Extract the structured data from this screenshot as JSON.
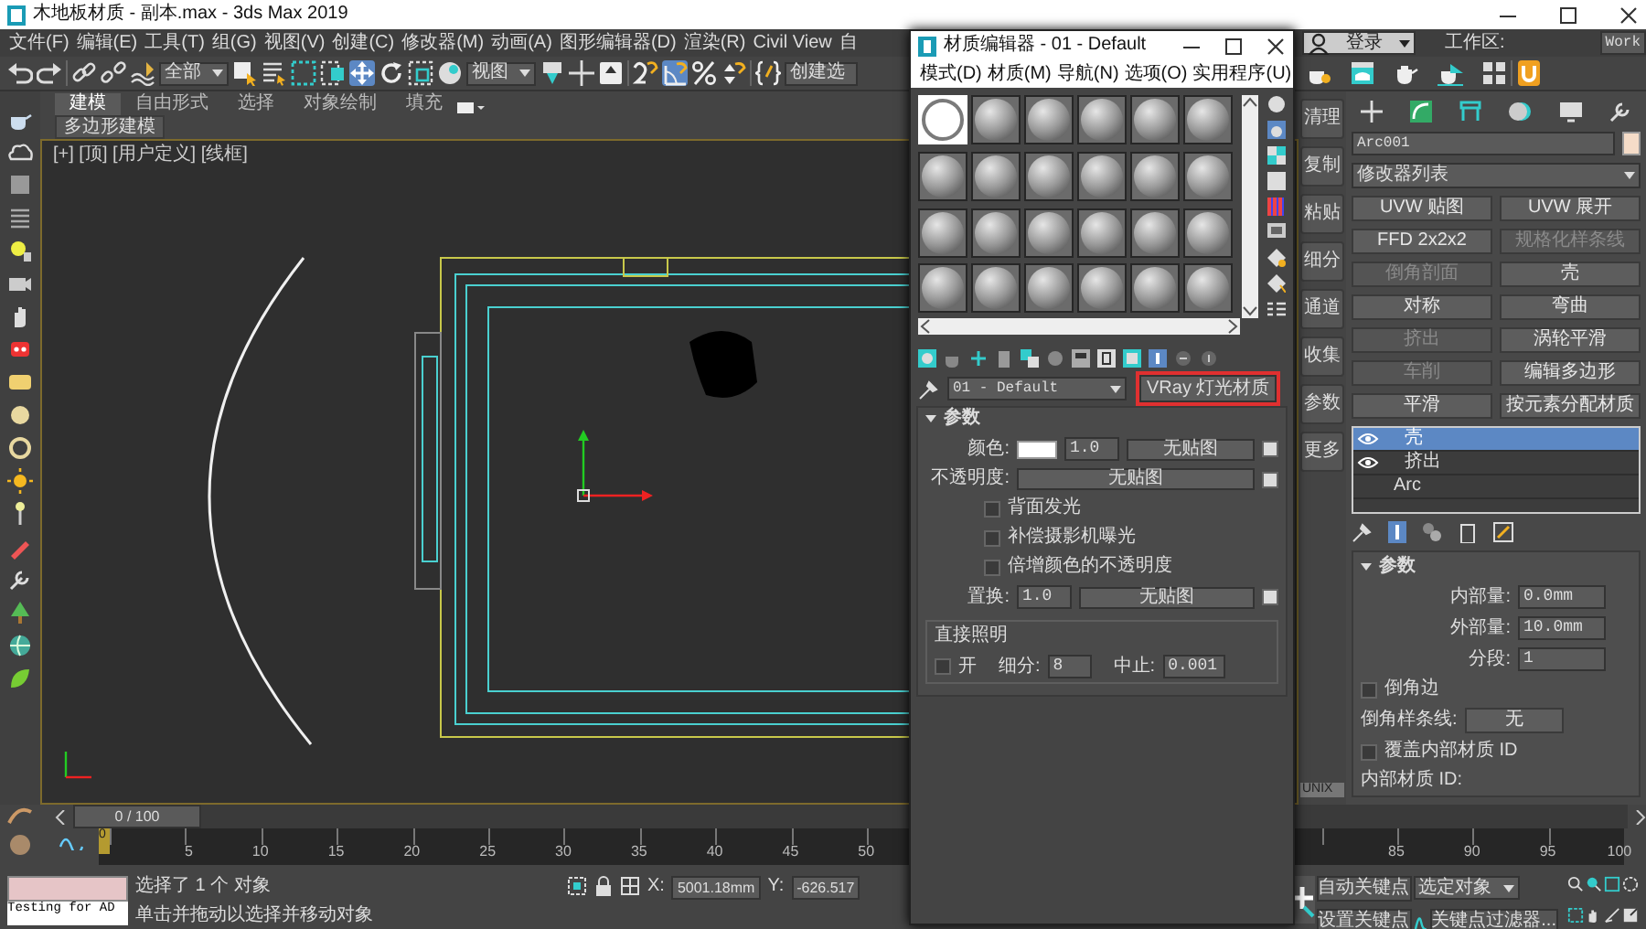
{
  "window": {
    "title": "木地板材质 - 副本.max - 3ds Max 2019"
  },
  "menu": [
    "文件(F)",
    "编辑(E)",
    "工具(T)",
    "组(G)",
    "视图(V)",
    "创建(C)",
    "修改器(M)",
    "动画(A)",
    "图形编辑器(D)",
    "渲染(R)",
    "Civil View",
    "自"
  ],
  "account": {
    "label": "登录",
    "workspace_label": "工作区:",
    "workspace_value": "Work"
  },
  "toolbar": {
    "selection_filter": "全部",
    "reference_coord": "视图",
    "named_selection": "创建选"
  },
  "ribbon": {
    "tabs": [
      {
        "label": "建模",
        "selected": true
      },
      {
        "label": "自由形式",
        "selected": false
      },
      {
        "label": "选择",
        "selected": false
      },
      {
        "label": "对象绘制",
        "selected": false
      },
      {
        "label": "填充",
        "selected": false
      }
    ],
    "panel": "多边形建模"
  },
  "viewport": {
    "label": "[+] [顶] [用户定义] [线框]"
  },
  "command_panel": {
    "side_buttons": [
      "清理",
      "复制",
      "粘贴",
      "细分",
      "通道",
      "收集",
      "参数",
      "更多"
    ],
    "unit_label": "UNIX",
    "object": {
      "name": "Arc001",
      "color": "#f5dcc8"
    },
    "modifier_list": "修改器列表",
    "modifier_buttons": [
      {
        "label": "UVW 贴图",
        "disabled": false
      },
      {
        "label": "UVW 展开",
        "disabled": false
      },
      {
        "label": "FFD 2x2x2",
        "disabled": false
      },
      {
        "label": "规格化样条线",
        "disabled": true
      },
      {
        "label": "倒角剖面",
        "disabled": true
      },
      {
        "label": "壳",
        "disabled": false
      },
      {
        "label": "对称",
        "disabled": false
      },
      {
        "label": "弯曲",
        "disabled": false
      },
      {
        "label": "挤出",
        "disabled": true
      },
      {
        "label": "涡轮平滑",
        "disabled": false
      },
      {
        "label": "车削",
        "disabled": true
      },
      {
        "label": "编辑多边形",
        "disabled": false
      },
      {
        "label": "平滑",
        "disabled": false
      },
      {
        "label": "按元素分配材质",
        "disabled": false
      }
    ],
    "stack": [
      {
        "label": "壳",
        "selected": true,
        "eye": true
      },
      {
        "label": "挤出",
        "selected": false,
        "eye": true
      },
      {
        "label": "Arc",
        "selected": false,
        "eye": false
      }
    ],
    "parameters": {
      "title": "参数",
      "fields": [
        {
          "label": "内部量:",
          "value": "0.0mm"
        },
        {
          "label": "外部量:",
          "value": "10.0mm"
        },
        {
          "label": "分段:",
          "value": "1"
        }
      ],
      "bevel_edges": {
        "label": "倒角边",
        "checked": false
      },
      "bevel_spline": {
        "label": "倒角样条线:",
        "value": "无"
      },
      "override_inner": {
        "label": "覆盖内部材质 ID",
        "checked": false
      },
      "inner_id_label": "内部材质 ID:"
    }
  },
  "timeline": {
    "frame_slider": "0 / 100",
    "level": 0,
    "current_frame": "0",
    "left_labels": [
      "5",
      "10",
      "15",
      "20",
      "25",
      "30",
      "35",
      "40",
      "45",
      "50"
    ],
    "right_labels": [
      "85",
      "90",
      "95",
      "100"
    ]
  },
  "status_bar": {
    "prompt_box": "Testing for AD",
    "selection": "选择了 1 个 对象",
    "hint": "单击并拖动以选择并移动对象",
    "x_label": "X:",
    "x_value": "5001.18mm",
    "y_label": "Y:",
    "y_value": "-626.517",
    "auto_key": "自动关键点",
    "key_mode": "选定对象",
    "set_key": "设置关键点",
    "key_filters": "关键点过滤器..."
  },
  "material_editor": {
    "title": "材质编辑器 - 01 - Default",
    "menu": [
      "模式(D)",
      "材质(M)",
      "导航(N)",
      "选项(O)",
      "实用程序(U)"
    ],
    "slots": [
      {
        "selected": true
      },
      {
        "selected": false
      },
      {
        "selected": false
      },
      {
        "selected": false
      },
      {
        "selected": false
      },
      {
        "selected": false
      },
      {
        "selected": false
      },
      {
        "selected": false
      },
      {
        "selected": false
      },
      {
        "selected": false
      },
      {
        "selected": false
      },
      {
        "selected": false
      },
      {
        "selected": false
      },
      {
        "selected": false
      },
      {
        "selected": false
      },
      {
        "selected": false
      },
      {
        "selected": false
      },
      {
        "selected": false
      },
      {
        "selected": false
      },
      {
        "selected": false
      },
      {
        "selected": false
      },
      {
        "selected": false
      },
      {
        "selected": false
      },
      {
        "selected": false
      }
    ],
    "material_name": "01 - Default",
    "material_type": "VRay 灯光材质",
    "type_highlighted": true,
    "rollout": {
      "title": "参数",
      "color": {
        "label": "颜色:",
        "color": "#ffffff",
        "multiplier": "1.0",
        "map": "无贴图",
        "enabled": true
      },
      "opacity": {
        "label": "不透明度:",
        "map": "无贴图",
        "enabled": true
      },
      "options": [
        {
          "label": "背面发光",
          "checked": false
        },
        {
          "label": "补偿摄影机曝光",
          "checked": false
        },
        {
          "label": "倍增颜色的不透明度",
          "checked": false
        }
      ],
      "displacement": {
        "label": "置换:",
        "amount": "1.0",
        "map": "无贴图",
        "enabled": true
      },
      "direct": {
        "title": "直接照明",
        "on": {
          "label": "开",
          "checked": false
        },
        "subdivs_label": "细分:",
        "subdivs": "8",
        "cutoff_label": "中止:",
        "cutoff": "0.001"
      }
    }
  }
}
